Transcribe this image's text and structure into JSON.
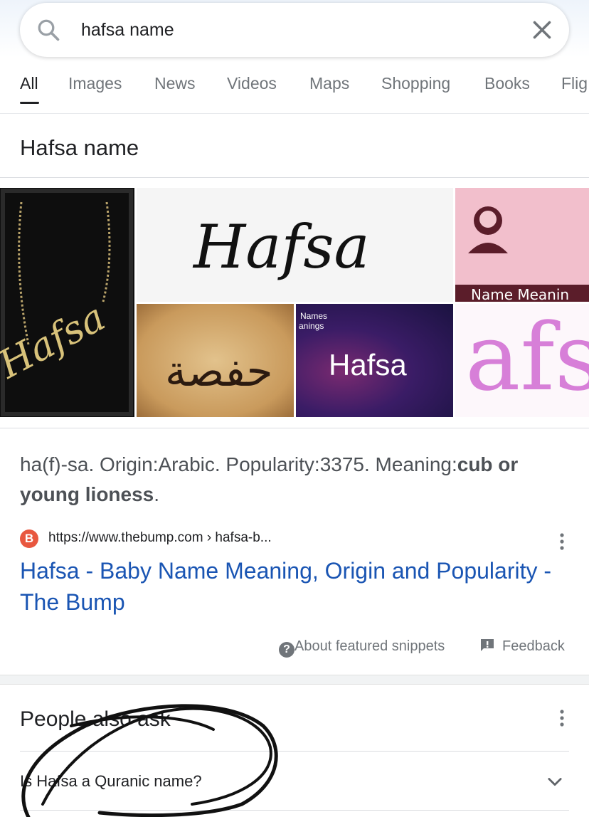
{
  "search": {
    "query": "hafsa name"
  },
  "tabs": [
    "All",
    "Images",
    "News",
    "Videos",
    "Maps",
    "Shopping",
    "Books",
    "Flig"
  ],
  "result": {
    "title": "Hafsa name",
    "images": {
      "necklace_text": "Hafsa",
      "script_text": "Hafsa",
      "arabic_text": "حفصة",
      "badge_text": "Names",
      "badge_sub": "anings",
      "video_text": "Hafsa",
      "pink_banner": "Name Meanin",
      "pink_letters": "afs"
    },
    "snippet_pre": "ha(f)-sa. Origin:Arabic. Popularity:3375. Meaning:",
    "snippet_bold": "cub or young lioness",
    "snippet_post": ".",
    "favicon_letter": "B",
    "url": "https://www.thebump.com › hafsa-b...",
    "link_title": "Hafsa - Baby Name Meaning, Origin and Popularity - The Bump",
    "about_label": "About featured snippets",
    "feedback_label": "Feedback"
  },
  "people_also_ask": {
    "title": "People also ask",
    "questions": [
      "Is Hafsa a Quranic name?"
    ]
  },
  "colors": {
    "link": "#1a55b3",
    "favicon": "#e8573f",
    "pink_tile": "#f2bfcc",
    "purple_tile": "#2a1858"
  }
}
